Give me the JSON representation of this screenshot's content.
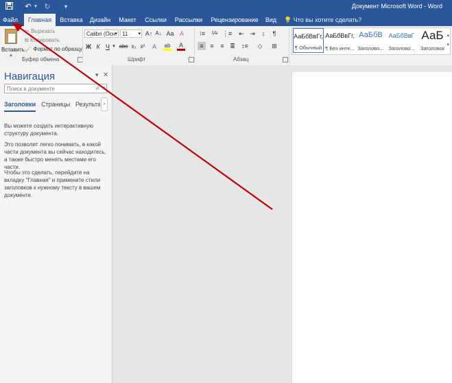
{
  "window": {
    "title": "Документ Microsoft Word - Word"
  },
  "qat": {
    "save_icon": "save-icon",
    "undo_icon": "undo-icon",
    "redo_icon": "redo-icon",
    "customize_icon": "chevron-down-icon"
  },
  "tabs": [
    {
      "label": "Файл"
    },
    {
      "label": "Главная"
    },
    {
      "label": "Вставка"
    },
    {
      "label": "Дизайн"
    },
    {
      "label": "Макет"
    },
    {
      "label": "Ссылки"
    },
    {
      "label": "Рассылки"
    },
    {
      "label": "Рецензирование"
    },
    {
      "label": "Вид"
    }
  ],
  "active_tab": "Главная",
  "tell_me": {
    "placeholder": "Что вы хотите сделать?"
  },
  "clipboard": {
    "paste_label": "Вставить",
    "cut_label": "Вырезать",
    "copy_label": "Копировать",
    "format_painter_label": "Формат по образцу",
    "group_label": "Буфер обмена"
  },
  "font": {
    "name": "Calibri (Осн.",
    "size": "11",
    "group_label": "Шрифт",
    "buttons": {
      "bold": "Ж",
      "italic": "К",
      "underline": "Ч",
      "strike": "abc",
      "subscript": "x₂",
      "superscript": "x²",
      "grow": "A↑",
      "shrink": "A↓",
      "case": "Aa",
      "clear": "A",
      "text_effects": "A",
      "highlight": "ab",
      "font_color": "A"
    }
  },
  "paragraph": {
    "group_label": "Абзац",
    "pilcrow": "¶"
  },
  "styles": [
    {
      "sample": "АаБбВвГг,",
      "name": "¶ Обычный"
    },
    {
      "sample": "АаБбВвГг,",
      "name": "¶ Без инте..."
    },
    {
      "sample": "АаБбВ",
      "name": "Заголово..."
    },
    {
      "sample": "АаБбВвГ",
      "name": "Заголово..."
    },
    {
      "sample": "АаБ",
      "name": "Заголовок"
    }
  ],
  "navigation": {
    "title": "Навигация",
    "search_placeholder": "Поиск в документе",
    "tabs": [
      {
        "label": "Заголовки"
      },
      {
        "label": "Страницы"
      },
      {
        "label": "Результать"
      }
    ],
    "paragraphs": [
      "Вы можете создать интерактивную структуру документа.",
      "Это позволит легко понимать, в какой части документа вы сейчас находитесь, а также быстро менять местами его части.",
      "Чтобы это сделать, перейдите на вкладку \"Главная\" и примените стили заголовков к нужному тексту в вашем документе."
    ]
  },
  "colors": {
    "accent": "#2b579a",
    "ribbon": "#f1f1f1",
    "arrow": "#c00000",
    "highlight": "#ffff00",
    "font_color": "#c00000"
  }
}
